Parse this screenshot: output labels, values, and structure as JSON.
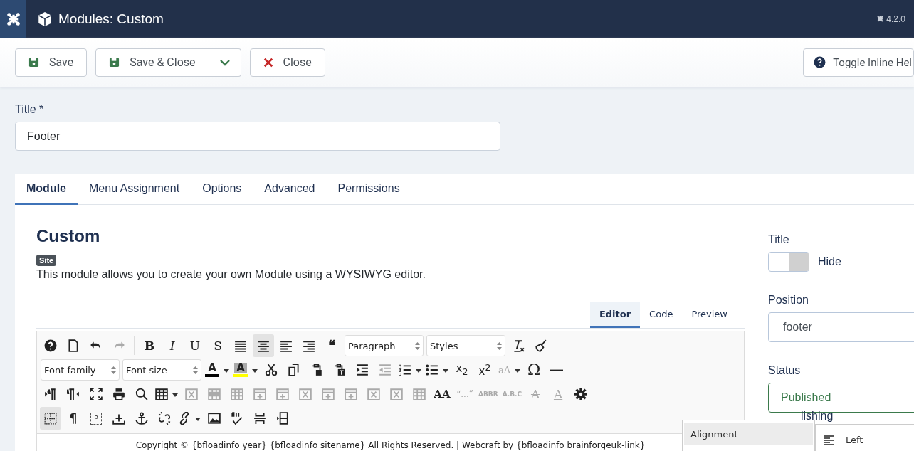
{
  "header": {
    "title": "Modules: Custom",
    "version": "4.2.0"
  },
  "actions": [
    {
      "kind": "save",
      "label": "Save"
    },
    {
      "kind": "save-close",
      "label": "Save & Close"
    },
    {
      "kind": "close",
      "label": "Close"
    }
  ],
  "help_button": {
    "label": "Toggle Inline Hel"
  },
  "title_field": {
    "label": "Title *",
    "value": "Footer"
  },
  "tabs": [
    {
      "label": "Module",
      "selected": true
    },
    {
      "label": "Menu Assignment",
      "selected": false
    },
    {
      "label": "Options",
      "selected": false
    },
    {
      "label": "Advanced",
      "selected": false
    },
    {
      "label": "Permissions",
      "selected": false
    }
  ],
  "module": {
    "heading": "Custom",
    "badge": "Site",
    "description": "This module allows you to create your own Module using a WYSIWYG editor."
  },
  "editor_tabs": [
    {
      "label": "Editor",
      "selected": true
    },
    {
      "label": "Code",
      "selected": false
    },
    {
      "label": "Preview",
      "selected": false
    }
  ],
  "toolbar_rows": [
    [
      {
        "kind": "help",
        "disabled": false,
        "pressed": false,
        "dropdown": false
      },
      {
        "kind": "new-document",
        "disabled": false,
        "pressed": false,
        "dropdown": false
      },
      {
        "kind": "undo",
        "disabled": false,
        "pressed": false,
        "dropdown": false
      },
      {
        "kind": "redo",
        "disabled": true,
        "pressed": false,
        "dropdown": false
      },
      {
        "kind": "separator"
      },
      {
        "kind": "bold",
        "glyph": "B",
        "disabled": false,
        "pressed": false,
        "dropdown": false
      },
      {
        "kind": "italic",
        "glyph": "I",
        "disabled": false,
        "pressed": false,
        "dropdown": false
      },
      {
        "kind": "underline",
        "glyph": "U",
        "disabled": false,
        "pressed": false,
        "dropdown": false
      },
      {
        "kind": "strike",
        "glyph": "S",
        "disabled": false,
        "pressed": false,
        "dropdown": false
      },
      {
        "kind": "justify",
        "disabled": false,
        "pressed": false,
        "dropdown": false
      },
      {
        "kind": "align-center",
        "disabled": false,
        "pressed": true,
        "dropdown": false
      },
      {
        "kind": "align-left",
        "disabled": false,
        "pressed": false,
        "dropdown": false
      },
      {
        "kind": "align-right",
        "disabled": false,
        "pressed": false,
        "dropdown": false
      },
      {
        "kind": "quote",
        "glyph": "❝",
        "disabled": false,
        "pressed": false,
        "dropdown": false
      },
      {
        "kind": "select",
        "value": "Paragraph"
      },
      {
        "kind": "select",
        "value": "Styles"
      },
      {
        "kind": "clear-format",
        "disabled": false,
        "pressed": false,
        "dropdown": false
      },
      {
        "kind": "brush",
        "disabled": false,
        "pressed": false,
        "dropdown": false
      }
    ],
    [
      {
        "kind": "select",
        "value": "Font family"
      },
      {
        "kind": "select",
        "value": "Font size"
      },
      {
        "kind": "text-color",
        "glyph": "A",
        "color": "#000000",
        "disabled": false,
        "pressed": false,
        "dropdown": true
      },
      {
        "kind": "highlight",
        "glyph": "A",
        "color": "#ffff00",
        "disabled": false,
        "pressed": false,
        "dropdown": true
      },
      {
        "kind": "cut",
        "disabled": false,
        "pressed": false,
        "dropdown": false
      },
      {
        "kind": "copy",
        "disabled": false,
        "pressed": false,
        "dropdown": false
      },
      {
        "kind": "paste",
        "disabled": false,
        "pressed": false,
        "dropdown": false
      },
      {
        "kind": "paste-text",
        "disabled": false,
        "pressed": false,
        "dropdown": false
      },
      {
        "kind": "indent",
        "disabled": false,
        "pressed": false,
        "dropdown": false
      },
      {
        "kind": "outdent",
        "disabled": true,
        "pressed": false,
        "dropdown": false
      },
      {
        "kind": "numbered-list",
        "disabled": false,
        "pressed": false,
        "dropdown": true
      },
      {
        "kind": "bullet-list",
        "disabled": false,
        "pressed": false,
        "dropdown": true
      },
      {
        "kind": "subscript",
        "glyph": "x$_{2}$",
        "disabled": false,
        "pressed": false,
        "dropdown": false
      },
      {
        "kind": "superscript",
        "glyph": "x$^{2}$",
        "disabled": false,
        "pressed": false,
        "dropdown": false
      },
      {
        "kind": "case",
        "glyph": "aA",
        "disabled": true,
        "pressed": false,
        "dropdown": true
      },
      {
        "kind": "omega",
        "glyph": "Ω",
        "disabled": false,
        "pressed": false,
        "dropdown": false
      },
      {
        "kind": "rule",
        "disabled": false,
        "pressed": false,
        "dropdown": false
      }
    ],
    [
      {
        "kind": "ltr",
        "disabled": false,
        "pressed": false,
        "dropdown": false
      },
      {
        "kind": "rtl",
        "disabled": false,
        "pressed": false,
        "dropdown": false
      },
      {
        "kind": "fullscreen",
        "disabled": false,
        "pressed": false,
        "dropdown": false
      },
      {
        "kind": "print",
        "disabled": false,
        "pressed": false,
        "dropdown": false
      },
      {
        "kind": "search",
        "disabled": false,
        "pressed": false,
        "dropdown": false
      },
      {
        "kind": "table",
        "disabled": false,
        "pressed": false,
        "dropdown": true
      },
      {
        "kind": "table-delete",
        "disabled": true,
        "pressed": false,
        "dropdown": false
      },
      {
        "kind": "table-row",
        "disabled": true,
        "pressed": false,
        "dropdown": false
      },
      {
        "kind": "table-cell",
        "disabled": true,
        "pressed": false,
        "dropdown": false
      },
      {
        "kind": "table-plus",
        "disabled": true,
        "pressed": false,
        "dropdown": false
      },
      {
        "kind": "table-plus",
        "disabled": true,
        "pressed": false,
        "dropdown": false
      },
      {
        "kind": "table-delete",
        "disabled": true,
        "pressed": false,
        "dropdown": false
      },
      {
        "kind": "table-plus",
        "disabled": true,
        "pressed": false,
        "dropdown": false
      },
      {
        "kind": "table-plus",
        "disabled": true,
        "pressed": false,
        "dropdown": false
      },
      {
        "kind": "table-delete",
        "disabled": true,
        "pressed": false,
        "dropdown": false
      },
      {
        "kind": "table-delete",
        "disabled": true,
        "pressed": false,
        "dropdown": false
      },
      {
        "kind": "table-cell",
        "disabled": true,
        "pressed": false,
        "dropdown": false
      },
      {
        "kind": "font-style",
        "glyph": "AA",
        "disabled": false,
        "pressed": false,
        "dropdown": false
      },
      {
        "kind": "cite",
        "glyph": "“...”",
        "disabled": true,
        "pressed": false,
        "dropdown": false
      },
      {
        "kind": "abbr",
        "glyph": "ABBR",
        "disabled": true,
        "pressed": false,
        "dropdown": false
      },
      {
        "kind": "abbr",
        "glyph": "A.B.C",
        "disabled": true,
        "pressed": false,
        "dropdown": false
      },
      {
        "kind": "strike-a",
        "glyph": "A",
        "disabled": true,
        "pressed": false,
        "dropdown": false
      },
      {
        "kind": "under-a",
        "glyph": "A",
        "disabled": true,
        "pressed": false,
        "dropdown": false
      },
      {
        "kind": "gear",
        "disabled": false,
        "pressed": false,
        "dropdown": false
      }
    ],
    [
      {
        "kind": "visual-aid",
        "disabled": false,
        "pressed": true,
        "dropdown": false
      },
      {
        "kind": "pilcrow",
        "glyph": "¶",
        "disabled": false,
        "pressed": false,
        "dropdown": false
      },
      {
        "kind": "p-block",
        "glyph": "P",
        "disabled": false,
        "pressed": false,
        "dropdown": false
      },
      {
        "kind": "insert",
        "disabled": false,
        "pressed": false,
        "dropdown": false
      },
      {
        "kind": "anchor",
        "disabled": false,
        "pressed": false,
        "dropdown": false
      },
      {
        "kind": "unlink",
        "disabled": false,
        "pressed": false,
        "dropdown": false
      },
      {
        "kind": "link",
        "disabled": false,
        "pressed": false,
        "dropdown": true
      },
      {
        "kind": "image",
        "disabled": false,
        "pressed": false,
        "dropdown": false
      },
      {
        "kind": "spellcheck",
        "disabled": false,
        "pressed": false,
        "dropdown": false
      },
      {
        "kind": "pagebreak",
        "disabled": false,
        "pressed": false,
        "dropdown": false
      },
      {
        "kind": "template",
        "disabled": false,
        "pressed": false,
        "dropdown": false
      }
    ]
  ],
  "editor_content": "Copyright © {bfloadinfo year} {bfloadinfo sitename} All Rights Reserved. | Webcraft by {bfloadinfo brainforgeuk-link}",
  "side": {
    "title_label": "Title",
    "title_toggle": {
      "on": true,
      "label": "Hide"
    },
    "position_label": "Position",
    "position_value": "footer",
    "status_label": "Status",
    "status_value": "Published",
    "partial_label": "lishing"
  },
  "context_menu": {
    "item": "Alignment",
    "submenu_item": "Left"
  }
}
